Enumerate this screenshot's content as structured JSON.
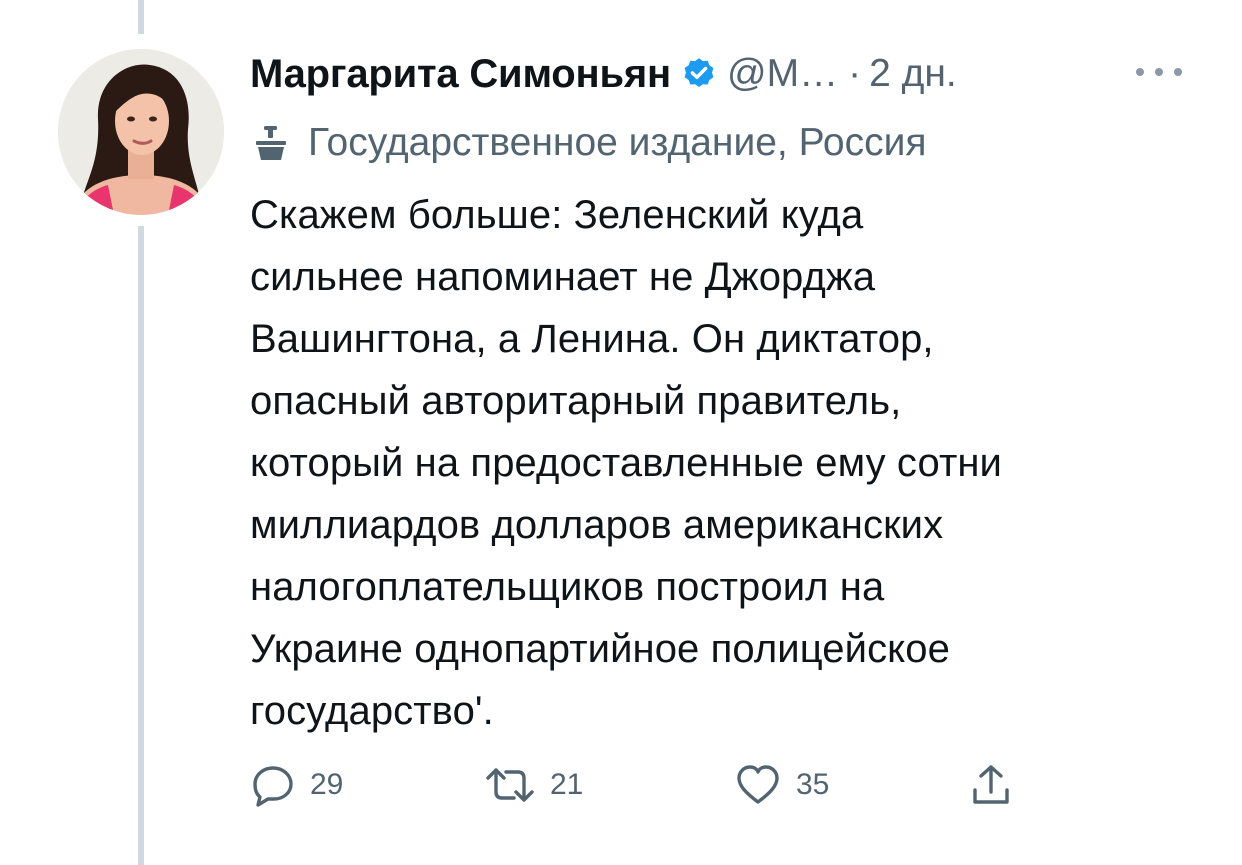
{
  "tweet": {
    "author_name": "Маргарита Симоньян",
    "handle": "@М…",
    "separator": "·",
    "time": "2 дн.",
    "affiliation_label": "Государственное издание, Россия",
    "text": "Скажем больше: Зеленский куда\nсильнее напоминает не Джорджа\nВашингтона, а Ленина. Он диктатор,\nопасный авторитарный правитель,\nкоторый на предоставленные ему сотни\nмиллиардов долларов американских\nналогоплательщиков построил на\nУкраине однопартийное полицейское\nгосударство'."
  },
  "actions": {
    "reply_count": "29",
    "retweet_count": "21",
    "like_count": "35"
  },
  "icons": {
    "verified": "verified-badge-icon",
    "affiliation": "state-media-podium-icon",
    "more": "more-options-icon",
    "reply": "reply-bubble-icon",
    "retweet": "retweet-icon",
    "like": "heart-icon",
    "share": "share-icon"
  },
  "colors": {
    "verified_blue": "#1d9bf0",
    "secondary_text": "#536471",
    "primary_text": "#0f1419",
    "thread_line": "#cfd9de"
  }
}
